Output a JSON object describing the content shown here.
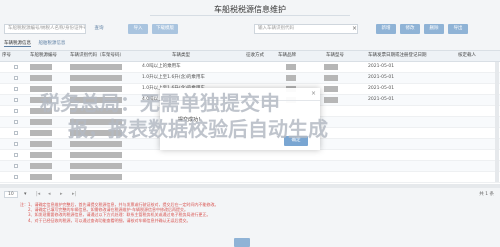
{
  "header": {
    "title": "车船税税源信息维护"
  },
  "toolbar": {
    "search_placeholder": "车船税税源编号/纳税人名称/身份证件号码",
    "query_label": "查询",
    "import_label": "导入",
    "download_label": "下载模版",
    "filter_placeholder": "输入车辆识别代码",
    "add_label": "新增",
    "edit_label": "修改",
    "delete_label": "删除",
    "export_label": "导出"
  },
  "tabs": [
    {
      "label": "车辆税源信息"
    },
    {
      "label": "船舶税源信息"
    }
  ],
  "table": {
    "headers": [
      "序号",
      "车船税源编号",
      "车辆识别代码（车架号码）",
      "车辆类型",
      "征收方式",
      "车辆品牌",
      "车辆型号",
      "车辆发票日期或注册登记日期",
      "核定载人"
    ],
    "rows": [
      {
        "type": "4.0吨以上的乘用车",
        "date": "2021-05-01"
      },
      {
        "type": "1.0升以上至1.6升(含)的乘用车",
        "date": "2021-05-01"
      },
      {
        "type": "1.0升以上至1.6升(含)的乘用车",
        "date": "2021-05-01"
      },
      {
        "type": "4.0吨以上的乘用车",
        "date": "2021-05-01"
      },
      {
        "type": "",
        "date": ""
      },
      {
        "type": "",
        "date": ""
      },
      {
        "type": "",
        "date": ""
      },
      {
        "type": "",
        "date": ""
      },
      {
        "type": "",
        "date": ""
      },
      {
        "type": "",
        "date": ""
      },
      {
        "type": "",
        "date": ""
      },
      {
        "type": "",
        "date": ""
      }
    ]
  },
  "overlay": {
    "line1": "税务总局：无需单独提交申",
    "line2": "报，报表数据校验后自动生成"
  },
  "dialog": {
    "message": "提交成功！",
    "confirm_label": "确定",
    "close": "×"
  },
  "pager": {
    "page_size": "10",
    "summary": "共 1 条"
  },
  "notes": [
    "注：1、请确定信息维护完整后，首先请提交税源信息，并与发票或行驶证核对，提交后在一定时间内不能修改。",
    "2、请确定已填写完整的车辆信息。如需修改请在税源维护-车辆税源信息中修改后再提交。",
    "3、如发现需要修改的税源信息，请通过以下方式处理：联系主管税务机关或通过电子税务局进行更正。",
    "4、对于已经征收的税源，可以通过查询功能查看明细，请核对车辆信息并确认无误后提交。"
  ]
}
